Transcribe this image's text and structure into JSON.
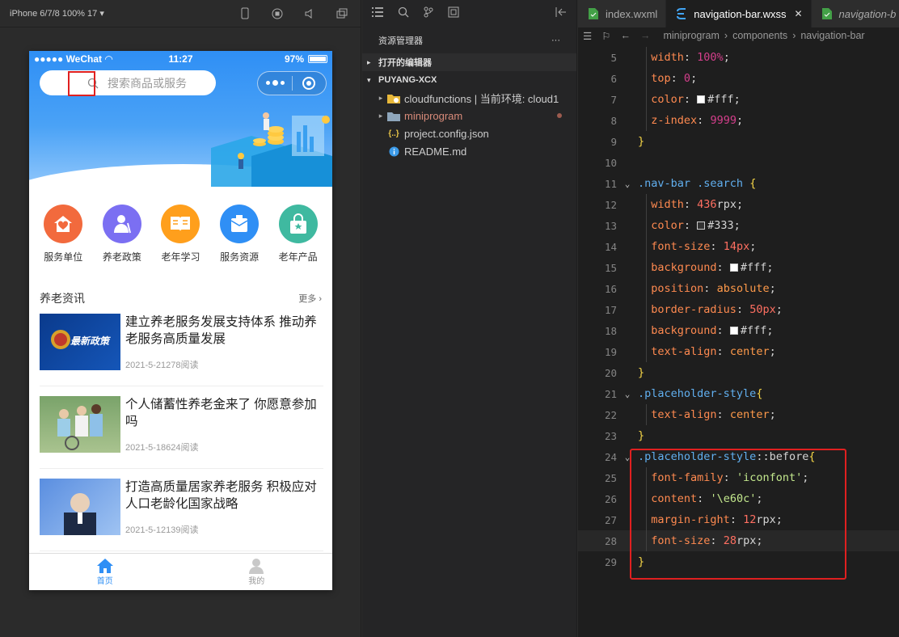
{
  "simulator": {
    "device_label": "iPhone 6/7/8 100% 17",
    "status": {
      "carrier": "●●●●● WeChat",
      "time": "11:27",
      "battery": "97%"
    },
    "search_placeholder": "搜索商品或服务",
    "grid": [
      {
        "label": "服务单位",
        "color": "#f26a3d",
        "icon": "house-heart-icon"
      },
      {
        "label": "养老政策",
        "color": "#7b6ff2",
        "icon": "elder-icon"
      },
      {
        "label": "老年学习",
        "color": "#ff9f1c",
        "icon": "book-icon"
      },
      {
        "label": "服务资源",
        "color": "#2f8ff5",
        "icon": "box-icon"
      },
      {
        "label": "老年产品",
        "color": "#3fb9a0",
        "icon": "bag-icon"
      }
    ],
    "news_section_title": "养老资讯",
    "news_more": "更多",
    "news": [
      {
        "title": "建立养老服务发展支持体系 推动养老服务高质量发展",
        "meta": "2021-5-21278阅读",
        "thumb_text": "最新政策"
      },
      {
        "title": "个人储蓄性养老金来了 你愿意参加吗",
        "meta": "2021-5-18624阅读",
        "thumb_text": ""
      },
      {
        "title": "打造高质量居家养老服务 积极应对人口老龄化国家战略",
        "meta": "2021-5-12139阅读",
        "thumb_text": ""
      }
    ],
    "tabs": [
      {
        "label": "首页",
        "active": true
      },
      {
        "label": "我的",
        "active": false
      }
    ]
  },
  "explorer": {
    "title": "资源管理器",
    "more": "···",
    "open_editors": "打开的编辑器",
    "project": "PUYANG-XCX",
    "items": [
      {
        "label": "cloudfunctions | 当前环境: cloud1",
        "kind": "folder-cloud",
        "arrow": "▸"
      },
      {
        "label": "miniprogram",
        "kind": "folder",
        "arrow": "▸",
        "modified": true
      },
      {
        "label": "project.config.json",
        "kind": "json",
        "arrow": ""
      },
      {
        "label": "README.md",
        "kind": "info",
        "arrow": ""
      }
    ]
  },
  "editor": {
    "tabs": [
      {
        "label": "index.wxml",
        "active": false,
        "icon": "wxml-icon"
      },
      {
        "label": "navigation-bar.wxss",
        "active": true,
        "icon": "css-icon"
      },
      {
        "label": "navigation-b",
        "active": false,
        "icon": "wxml-icon"
      }
    ],
    "breadcrumb": [
      "miniprogram",
      "components",
      "navigation-bar"
    ],
    "lines": [
      {
        "n": "5",
        "html": "  <span class='prop'>width</span>: <span class='num'>100%</span>;"
      },
      {
        "n": "6",
        "html": "  <span class='prop'>top</span>: <span class='num'>0</span>;"
      },
      {
        "n": "7",
        "html": "  <span class='prop'>color</span>: <span class='sw' style='background:#fff'></span>#fff;"
      },
      {
        "n": "8",
        "html": "  <span class='prop'>z-index</span>: <span class='num'>9999</span>;"
      },
      {
        "n": "9",
        "html": "<span class='brace'>}</span>"
      },
      {
        "n": "10",
        "html": ""
      },
      {
        "n": "11",
        "fold": true,
        "html": "<span class='sel'>.nav-bar .search</span> <span class='brace'>{</span>"
      },
      {
        "n": "12",
        "html": "  <span class='prop'>width</span>: <span class='numc'>436</span>rpx;"
      },
      {
        "n": "13",
        "html": "  <span class='prop'>color</span>: <span class='sw' style='background:#333'></span>#333;"
      },
      {
        "n": "14",
        "html": "  <span class='prop'>font-size</span>: <span class='numc'>14px</span>;"
      },
      {
        "n": "15",
        "html": "  <span class='prop'>background</span>: <span class='sw' style='background:#fff'></span>#fff;"
      },
      {
        "n": "16",
        "html": "  <span class='prop'>position</span>: <span class='kw'>absolute</span>;"
      },
      {
        "n": "17",
        "html": "  <span class='prop'>border-radius</span>: <span class='numc'>50px</span>;"
      },
      {
        "n": "18",
        "html": "  <span class='prop'>background</span>: <span class='sw' style='background:#fff'></span>#fff;"
      },
      {
        "n": "19",
        "html": "  <span class='prop'>text-align</span>: <span class='kw'>center</span>;"
      },
      {
        "n": "20",
        "html": "<span class='brace'>}</span>"
      },
      {
        "n": "21",
        "fold": true,
        "html": "<span class='sel'>.placeholder-style</span><span class='brace'>{</span>"
      },
      {
        "n": "22",
        "html": "  <span class='prop'>text-align</span>: <span class='kw'>center</span>;"
      },
      {
        "n": "23",
        "html": "<span class='brace'>}</span>"
      },
      {
        "n": "24",
        "fold": true,
        "html": "<span class='sel'>.placeholder-style</span>::before<span class='brace'>{</span>"
      },
      {
        "n": "25",
        "html": "  <span class='prop'>font-family</span>: <span class='str'>'iconfont'</span>;"
      },
      {
        "n": "26",
        "html": "  <span class='prop'>content</span>: <span class='str'>'\\e60c'</span>;"
      },
      {
        "n": "27",
        "html": "  <span class='prop'>margin-right</span>: <span class='numc'>12</span>rpx;"
      },
      {
        "n": "28",
        "hl": true,
        "html": "  <span class='prop'>font-size</span>: <span class='numc'>28</span>rpx;"
      },
      {
        "n": "29",
        "html": "<span class='brace'>}</span>"
      }
    ]
  }
}
